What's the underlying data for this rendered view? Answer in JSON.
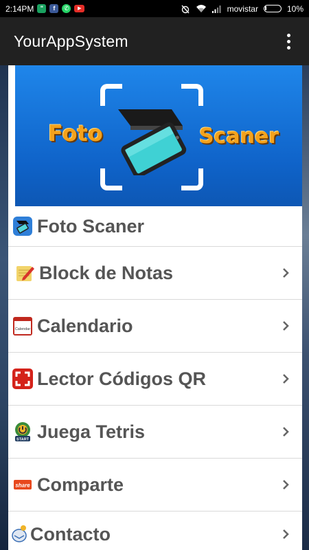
{
  "status_bar": {
    "time": "2:14PM",
    "carrier": "movistar",
    "battery": "10%"
  },
  "app_bar": {
    "title": "YourAppSystem"
  },
  "banner": {
    "word_left": "Foto",
    "word_right": "Scaner"
  },
  "menu": {
    "items": [
      {
        "label": "Foto Scaner",
        "icon": "scanner-icon",
        "chevron": false
      },
      {
        "label": "Block de Notas",
        "icon": "notepad-icon",
        "chevron": true
      },
      {
        "label": "Calendario",
        "icon": "calendar-icon",
        "chevron": true
      },
      {
        "label": "Lector Códigos QR",
        "icon": "qr-scan-icon",
        "chevron": true
      },
      {
        "label": "Juega Tetris",
        "icon": "tetris-icon",
        "chevron": true
      },
      {
        "label": "Comparte",
        "icon": "share-icon",
        "chevron": true
      },
      {
        "label": "Contacto",
        "icon": "contact-icon",
        "chevron": true
      }
    ],
    "calendar_icon_text": "Calendar",
    "tetris_icon_text": "START",
    "share_icon_text": "share"
  },
  "colors": {
    "app_bar": "#212121",
    "banner_blue": "#1f86ea",
    "banner_text": "#f4a21c",
    "label_text": "#555555"
  }
}
